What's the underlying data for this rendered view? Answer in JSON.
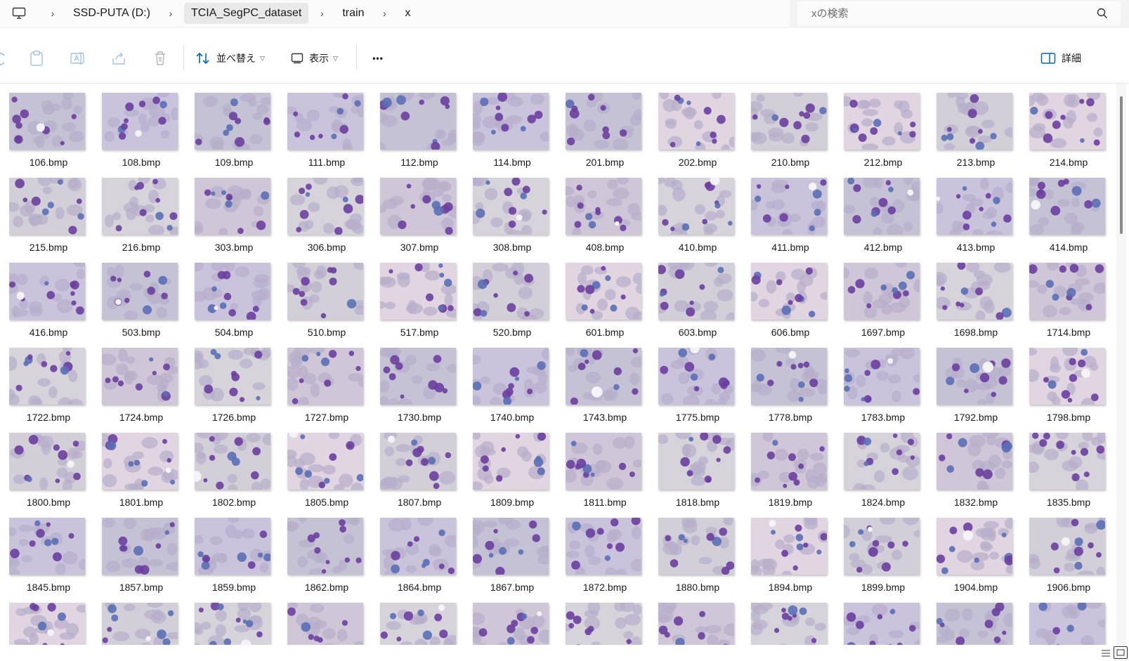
{
  "address_bar": {
    "crumbs": [
      "SSD-PUTA (D:)",
      "TCIA_SegPC_dataset",
      "train",
      "x"
    ],
    "separator": "›"
  },
  "search": {
    "placeholder": "xの検索"
  },
  "toolbar": {
    "sort_label": "並べ替え",
    "view_label": "表示",
    "more_label": "•••",
    "details_label": "詳細"
  },
  "files": [
    "106.bmp",
    "108.bmp",
    "109.bmp",
    "111.bmp",
    "112.bmp",
    "114.bmp",
    "201.bmp",
    "202.bmp",
    "210.bmp",
    "212.bmp",
    "213.bmp",
    "214.bmp",
    "215.bmp",
    "216.bmp",
    "303.bmp",
    "306.bmp",
    "307.bmp",
    "308.bmp",
    "408.bmp",
    "410.bmp",
    "411.bmp",
    "412.bmp",
    "413.bmp",
    "414.bmp",
    "416.bmp",
    "503.bmp",
    "504.bmp",
    "510.bmp",
    "517.bmp",
    "520.bmp",
    "601.bmp",
    "603.bmp",
    "606.bmp",
    "1697.bmp",
    "1698.bmp",
    "1714.bmp",
    "1722.bmp",
    "1724.bmp",
    "1726.bmp",
    "1727.bmp",
    "1730.bmp",
    "1740.bmp",
    "1743.bmp",
    "1775.bmp",
    "1778.bmp",
    "1783.bmp",
    "1792.bmp",
    "1798.bmp",
    "1800.bmp",
    "1801.bmp",
    "1802.bmp",
    "1805.bmp",
    "1807.bmp",
    "1809.bmp",
    "1811.bmp",
    "1818.bmp",
    "1819.bmp",
    "1824.bmp",
    "1832.bmp",
    "1835.bmp",
    "1845.bmp",
    "1857.bmp",
    "1859.bmp",
    "1862.bmp",
    "1864.bmp",
    "1867.bmp",
    "1872.bmp",
    "1880.bmp",
    "1894.bmp",
    "1899.bmp",
    "1904.bmp",
    "1906.bmp",
    "",
    "",
    "",
    "",
    "",
    "",
    "",
    "",
    "",
    "",
    "",
    ""
  ],
  "colors": {
    "accent": "#0067c0",
    "cell_purple": "#6a3f9e",
    "cell_blue": "#5a6fb5"
  }
}
